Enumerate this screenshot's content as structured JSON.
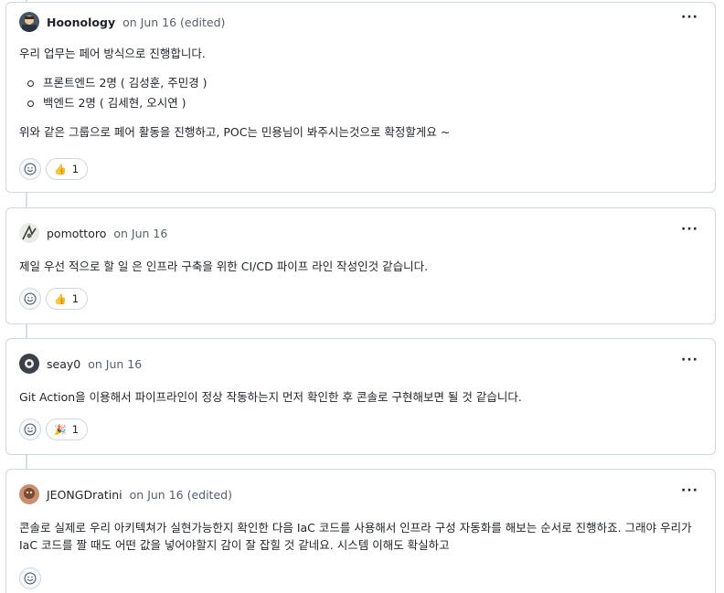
{
  "comments": [
    {
      "author": "Hoonology",
      "meta": "on Jun 16 (edited)",
      "intro": "우리 업무는 페어 방식으로 진행합니다.",
      "list": [
        "프론트엔드 2명 ( 김성훈, 주민경 )",
        "백엔드 2명 ( 김세현, 오시연 )"
      ],
      "outro": "위와 같은 그룹으로 페어 활동을 진행하고, POC는 민용님이 봐주시는것으로 확정할게요 ~",
      "reaction": {
        "emoji": "👍",
        "count": "1"
      }
    },
    {
      "author": "pomottoro",
      "meta": "on Jun 16",
      "text": "제일 우선 적으로 할 일 은 인프라 구축을 위한 CI/CD 파이프 라인 작성인것 같습니다.",
      "reaction": {
        "emoji": "👍",
        "count": "1"
      }
    },
    {
      "author": "seay0",
      "meta": "on Jun 16",
      "text": "Git Action을 이용해서 파이프라인이 정상 작동하는지 먼저 확인한 후 콘솔로 구현해보면 될 것 같습니다.",
      "reaction": {
        "emoji": "🎉",
        "count": "1"
      }
    },
    {
      "author": "JEONGDratini",
      "meta": "on Jun 16 (edited)",
      "text": "콘솔로 실제로 우리 아키텍쳐가 실현가능한지 확인한 다음 IaC 코드를 사용해서 인프라 구성 자동화를 해보는 순서로 진행하죠. 그래야 우리가 IaC 코드를 짤 때도 어떤 값을 넣어야할지 감이 잘 잡힐 것 같네요. 시스템 이해도 확실하고"
    }
  ],
  "icons": {
    "more": "kebab-horizontal-icon",
    "add_reaction": "smiley-icon"
  }
}
